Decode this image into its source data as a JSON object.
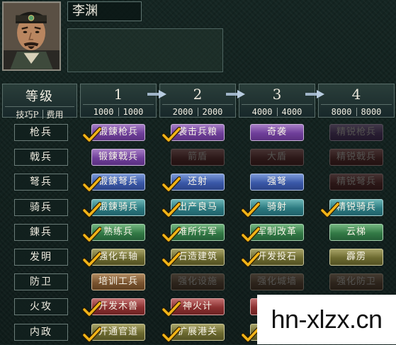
{
  "character": {
    "name": "李渊"
  },
  "header": {
    "level_title": "等级",
    "level_sub_left": "技巧P",
    "level_sub_right": "费用",
    "levels": [
      {
        "num": "1",
        "tp": "1000",
        "cost": "1000"
      },
      {
        "num": "2",
        "tp": "2000",
        "cost": "2000"
      },
      {
        "num": "3",
        "tp": "4000",
        "cost": "4000"
      },
      {
        "num": "4",
        "tp": "8000",
        "cost": "8000"
      }
    ]
  },
  "rows": [
    {
      "label": "枪兵",
      "cells": [
        {
          "text": "锻鍊枪兵",
          "color": "purple",
          "learned": true
        },
        {
          "text": "袭击兵粮",
          "color": "purple",
          "learned": true
        },
        {
          "text": "奇袭",
          "color": "purple",
          "learned": false
        },
        {
          "text": "精锐枪兵",
          "color": "purple",
          "learned": false,
          "dim": true
        }
      ]
    },
    {
      "label": "戟兵",
      "cells": [
        {
          "text": "锻鍊戟兵",
          "color": "purple",
          "learned": false
        },
        {
          "text": "箭盾",
          "color": "red",
          "learned": false,
          "dim": true
        },
        {
          "text": "大盾",
          "color": "red",
          "learned": false,
          "dim": true
        },
        {
          "text": "精锐戟兵",
          "color": "red",
          "learned": false,
          "dim": true
        }
      ]
    },
    {
      "label": "弩兵",
      "cells": [
        {
          "text": "锻鍊弩兵",
          "color": "blue",
          "learned": true
        },
        {
          "text": "还射",
          "color": "blue",
          "learned": true
        },
        {
          "text": "强弩",
          "color": "blue",
          "learned": false
        },
        {
          "text": "精锐弩兵",
          "color": "red",
          "learned": false,
          "dim": true
        }
      ]
    },
    {
      "label": "骑兵",
      "cells": [
        {
          "text": "锻鍊骑兵",
          "color": "teal",
          "learned": true
        },
        {
          "text": "出产良马",
          "color": "teal",
          "learned": true
        },
        {
          "text": "骑射",
          "color": "teal",
          "learned": true
        },
        {
          "text": "精锐骑兵",
          "color": "teal",
          "learned": true
        }
      ]
    },
    {
      "label": "鍊兵",
      "cells": [
        {
          "text": "熟练兵",
          "color": "green",
          "learned": true
        },
        {
          "text": "难所行军",
          "color": "green",
          "learned": true
        },
        {
          "text": "军制改革",
          "color": "green",
          "learned": true
        },
        {
          "text": "云梯",
          "color": "green",
          "learned": false
        }
      ]
    },
    {
      "label": "发明",
      "cells": [
        {
          "text": "强化车轴",
          "color": "olive",
          "learned": true
        },
        {
          "text": "石造建筑",
          "color": "olive",
          "learned": true
        },
        {
          "text": "开发投石",
          "color": "olive",
          "learned": true
        },
        {
          "text": "霹雳",
          "color": "olive",
          "learned": false
        }
      ]
    },
    {
      "label": "防卫",
      "cells": [
        {
          "text": "培训工兵",
          "color": "brown",
          "learned": false
        },
        {
          "text": "强化设施",
          "color": "brown",
          "learned": false,
          "dim": true
        },
        {
          "text": "强化城墙",
          "color": "brown",
          "learned": false,
          "dim": true
        },
        {
          "text": "强化防卫",
          "color": "brown",
          "learned": false,
          "dim": true
        }
      ]
    },
    {
      "label": "火攻",
      "cells": [
        {
          "text": "开发木兽",
          "color": "red",
          "learned": true
        },
        {
          "text": "神火计",
          "color": "red",
          "learned": true
        },
        {
          "text": "",
          "color": "red",
          "learned": false
        },
        {
          "text": "",
          "color": "red",
          "learned": false
        }
      ]
    },
    {
      "label": "内政",
      "cells": [
        {
          "text": "开通官道",
          "color": "olive",
          "learned": true
        },
        {
          "text": "扩展港关",
          "color": "olive",
          "learned": true
        },
        {
          "text": "",
          "color": "olive",
          "learned": true
        },
        {
          "text": "",
          "color": "olive",
          "learned": false
        }
      ]
    }
  ],
  "watermark": {
    "text": "hn-xlzx.cn"
  }
}
